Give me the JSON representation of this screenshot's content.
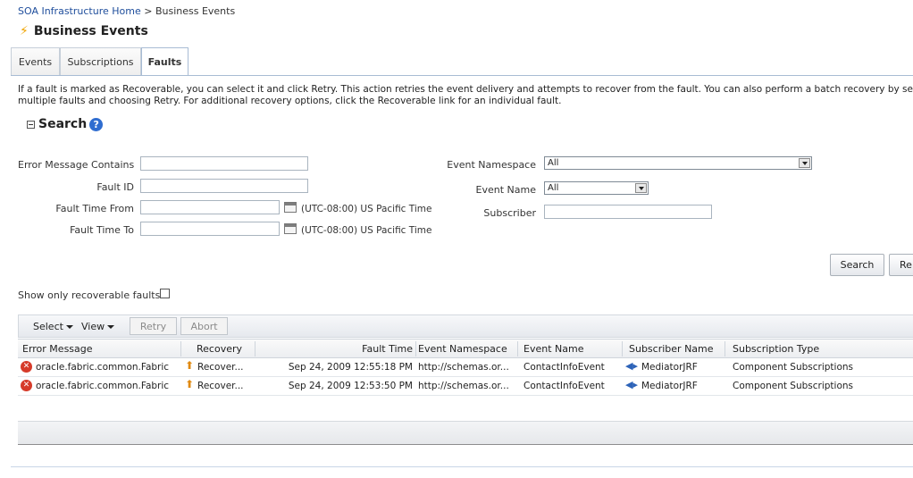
{
  "breadcrumb": {
    "root": "SOA Infrastructure Home",
    "separator": ">",
    "current": "Business Events"
  },
  "page_title": "Business Events",
  "tabs": [
    {
      "label": "Events"
    },
    {
      "label": "Subscriptions"
    },
    {
      "label": "Faults"
    }
  ],
  "description": {
    "line1": "If a fault is marked as Recoverable, you can select it and click Retry. This action retries the event delivery and attempts to recover from the fault. You can also perform a batch recovery by selecti",
    "line2": "multiple faults and choosing Retry. For additional recovery options, click the Recoverable link for an individual fault."
  },
  "search": {
    "title": "Search",
    "help_icon": "?",
    "fields": {
      "error_message_label": "Error Message Contains",
      "error_message_value": "",
      "fault_id_label": "Fault ID",
      "fault_id_value": "",
      "fault_time_from_label": "Fault Time From",
      "fault_time_from_value": "",
      "fault_time_to_label": "Fault Time To",
      "fault_time_to_value": "",
      "timezone": "(UTC-08:00) US Pacific Time",
      "event_namespace_label": "Event Namespace",
      "event_namespace_value": "All",
      "event_name_label": "Event Name",
      "event_name_value": "All",
      "subscriber_label": "Subscriber",
      "subscriber_value": ""
    },
    "search_button": "Search",
    "reset_button": "Re"
  },
  "recoverable_checkbox_label": "Show only recoverable faults",
  "recoverable_checked": false,
  "toolbar": {
    "select": "Select",
    "view": "View",
    "retry": "Retry",
    "abort": "Abort"
  },
  "table": {
    "columns": [
      "Error Message",
      "Recovery",
      "Fault Time",
      "Event Namespace",
      "Event Name",
      "Subscriber Name",
      "Subscription Type"
    ],
    "rows": [
      {
        "error": "oracle.fabric.common.Fabric",
        "recovery": "Recover...",
        "time": "Sep 24, 2009 12:55:18 PM",
        "namespace": "http://schemas.or...",
        "event": "ContactInfoEvent",
        "subscriber": "MediatorJRF",
        "type": "Component Subscriptions"
      },
      {
        "error": "oracle.fabric.common.Fabric",
        "recovery": "Recover...",
        "time": "Sep 24, 2009 12:53:50 PM",
        "namespace": "http://schemas.or...",
        "event": "ContactInfoEvent",
        "subscriber": "MediatorJRF",
        "type": "Component Subscriptions"
      }
    ]
  },
  "icons": {
    "title": "lightning-bolt-icon",
    "error": "error-x-icon",
    "recovery": "recover-icon",
    "subscriber": "mediator-icon",
    "calendar": "calendar-icon"
  },
  "colors": {
    "link": "#1f4e9c",
    "error": "#d63b2a",
    "accent": "#f0a400"
  }
}
